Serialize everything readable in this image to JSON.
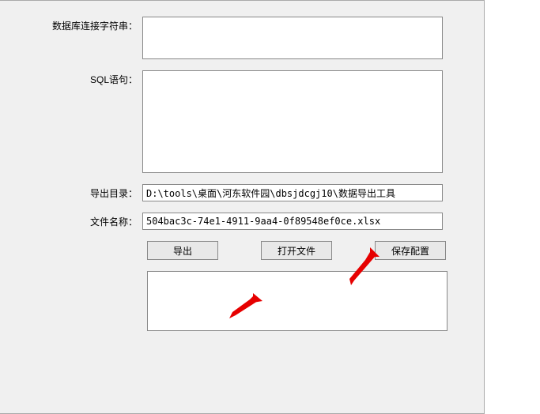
{
  "labels": {
    "db_conn": "数据库连接字符串：",
    "sql": "SQL语句：",
    "export_dir": "导出目录：",
    "file_name": "文件名称："
  },
  "fields": {
    "db_conn": "",
    "sql": "",
    "export_dir": "D:\\tools\\桌面\\河东软件园\\dbsjdcgj10\\数据导出工具",
    "file_name": "504bac3c-74e1-4911-9aa4-0f89548ef0ce.xlsx",
    "log": ""
  },
  "buttons": {
    "export": "导出",
    "open_file": "打开文件",
    "save_config": "保存配置"
  }
}
